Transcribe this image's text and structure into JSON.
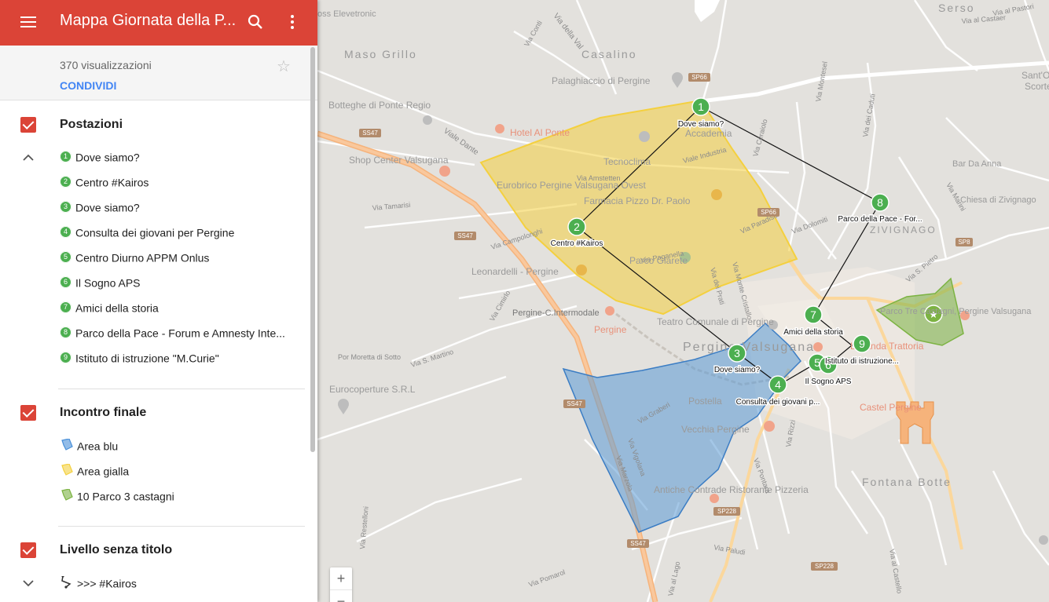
{
  "header": {
    "title": "Mappa Giornata della P..."
  },
  "info": {
    "views": "370 visualizzazioni",
    "share_label": "CONDIVIDI"
  },
  "layers": [
    {
      "title": "Postazioni",
      "items": [
        {
          "num": "1",
          "label": "Dove siamo?"
        },
        {
          "num": "2",
          "label": "Centro #Kairos"
        },
        {
          "num": "3",
          "label": "Dove siamo?"
        },
        {
          "num": "4",
          "label": "Consulta dei giovani per Pergine"
        },
        {
          "num": "5",
          "label": "Centro Diurno APPM Onlus"
        },
        {
          "num": "6",
          "label": "Il Sogno APS"
        },
        {
          "num": "7",
          "label": "Amici della storia"
        },
        {
          "num": "8",
          "label": "Parco della Pace - Forum e Amnesty Inte..."
        },
        {
          "num": "9",
          "label": "Istituto di istruzione \"M.Curie\""
        }
      ]
    },
    {
      "title": "Incontro finale",
      "items": [
        {
          "label": "Area blu",
          "color": "#4a90d9"
        },
        {
          "label": "Area gialla",
          "color": "#f4d03f"
        },
        {
          "label": "10 Parco 3 castagni",
          "color": "#7cb342"
        }
      ]
    },
    {
      "title": "Livello senza titolo",
      "items": [
        {
          "label": ">>> #Kairos"
        }
      ]
    }
  ],
  "map": {
    "places": {
      "maso_grillo": "Maso Grillo",
      "casalino": "Casalino",
      "serso": "Serso",
      "zivignago": "ZIVIGNAGO",
      "fontana_botte": "Fontana Botte",
      "pergine": "Pergine Valsugana",
      "sant_o": "Sant'O",
      "scorte": "Scorte"
    },
    "pois": {
      "palaghiaccio": "Palaghiaccio di Pergine",
      "botteghe": "Botteghe di Ponte Regio",
      "hotel": "Hotel Al Ponte",
      "shop_center": "Shop Center Valsugana",
      "eurobrico": "Eurobrico Pergine Valsugana Ovest",
      "tecnoclima": "Tecnoclima",
      "accademia": "Accademia",
      "farmacia": "Farmacia Pizzo Dr. Paolo",
      "leonardelli": "Leonardelli - Pergine",
      "parco_giarete": "Parco Giarete",
      "pergine_intermodale": "Pergine-C.Intermodale",
      "pergine_station": "Pergine",
      "teatro": "Teatro Comunale di Pergine",
      "eurocoperture": "Eurocoperture S.R.L",
      "postella": "Postella",
      "vecchia_pergine": "Vecchia Pergine",
      "antiche_contrade": "Antiche Contrade Ristorante Pizzeria",
      "bar_da_anna": "Bar Da Anna",
      "chiesa": "Chiesa di Zivignago",
      "parco_tre_castagni": "Parco Tre Castagni, Pergine Valsugana",
      "locanda": "Locanda Trattoria",
      "castel_pergine": "Castel Pergine",
      "eleve": "oss Elevetronic"
    },
    "streets": {
      "via_della_val": "Via della Val",
      "via_conti": "Via Conti",
      "via_pastori": "Via al Pastori",
      "via_castaer": "Via al Castaer",
      "viale_dante": "Viale Dante",
      "via_amstetten": "Via Amstetten",
      "via_industria": "Viale Industria",
      "via_tamarisi": "Via Tamarisi",
      "via_campolonghi": "Via Campolonghi",
      "via_paganella": "Via Paganella",
      "via_paradiso": "Via Paradiso",
      "via_monte_cristallo": "Via Monte Cristallo",
      "via_prati": "Via dei Prati",
      "via_dolomiti": "Via Dolomiti",
      "via_monteset": "Via Montesel",
      "via_cadiuti": "Via dei Caduti",
      "via_ceraiolo": "Via Ceraiolo",
      "via_marini": "Via Marini",
      "via_piazze": "Via S. Pietro",
      "via_cimirlo": "Via Cimirlo",
      "via_s_martino": "Via S. Martino",
      "via_moretta": "Por Moretta di Sotto",
      "via_graberi": "Via Graberi",
      "via_vigolana": "Via Vigolana",
      "via_marzola": "Via Marzola",
      "via_pontara": "Via Pontara",
      "via_rizzi": "Via Rizzi",
      "via_al_lago": "Via al Lago",
      "via_pomarol": "Via Pomarol",
      "via_paludi": "Via Paludi",
      "via_castello": "Via al Castello",
      "via_rosatone": "Via Restelloni"
    },
    "shields": {
      "sp66a": "SP66",
      "ss47a": "SS47",
      "ss47b": "SS47",
      "ss47c": "SS47",
      "ss47d": "SS47",
      "sp66b": "SP66",
      "sp8": "SP8",
      "sp228a": "SP228",
      "sp228b": "SP228"
    },
    "markers": [
      {
        "num": "1",
        "label": "Dove siamo?"
      },
      {
        "num": "2",
        "label": "Centro #Kairos"
      },
      {
        "num": "3",
        "label": "Dove siamo?"
      },
      {
        "num": "4",
        "label": "Consulta dei giovani p..."
      },
      {
        "num": "5",
        "label": ""
      },
      {
        "num": "6",
        "label": "Il Sogno APS"
      },
      {
        "num": "7",
        "label": "Amici della storia"
      },
      {
        "num": "8",
        "label": "Parco della Pace - For..."
      },
      {
        "num": "9",
        "label": "Istituto di istruzione..."
      }
    ],
    "zoom_in": "+",
    "zoom_out": "−",
    "colors": {
      "yellow_area": "#f4d03f",
      "blue_area": "#5b9bd5",
      "green_area": "#7cb342",
      "marker": "#4caf50",
      "header": "#db4437"
    }
  }
}
